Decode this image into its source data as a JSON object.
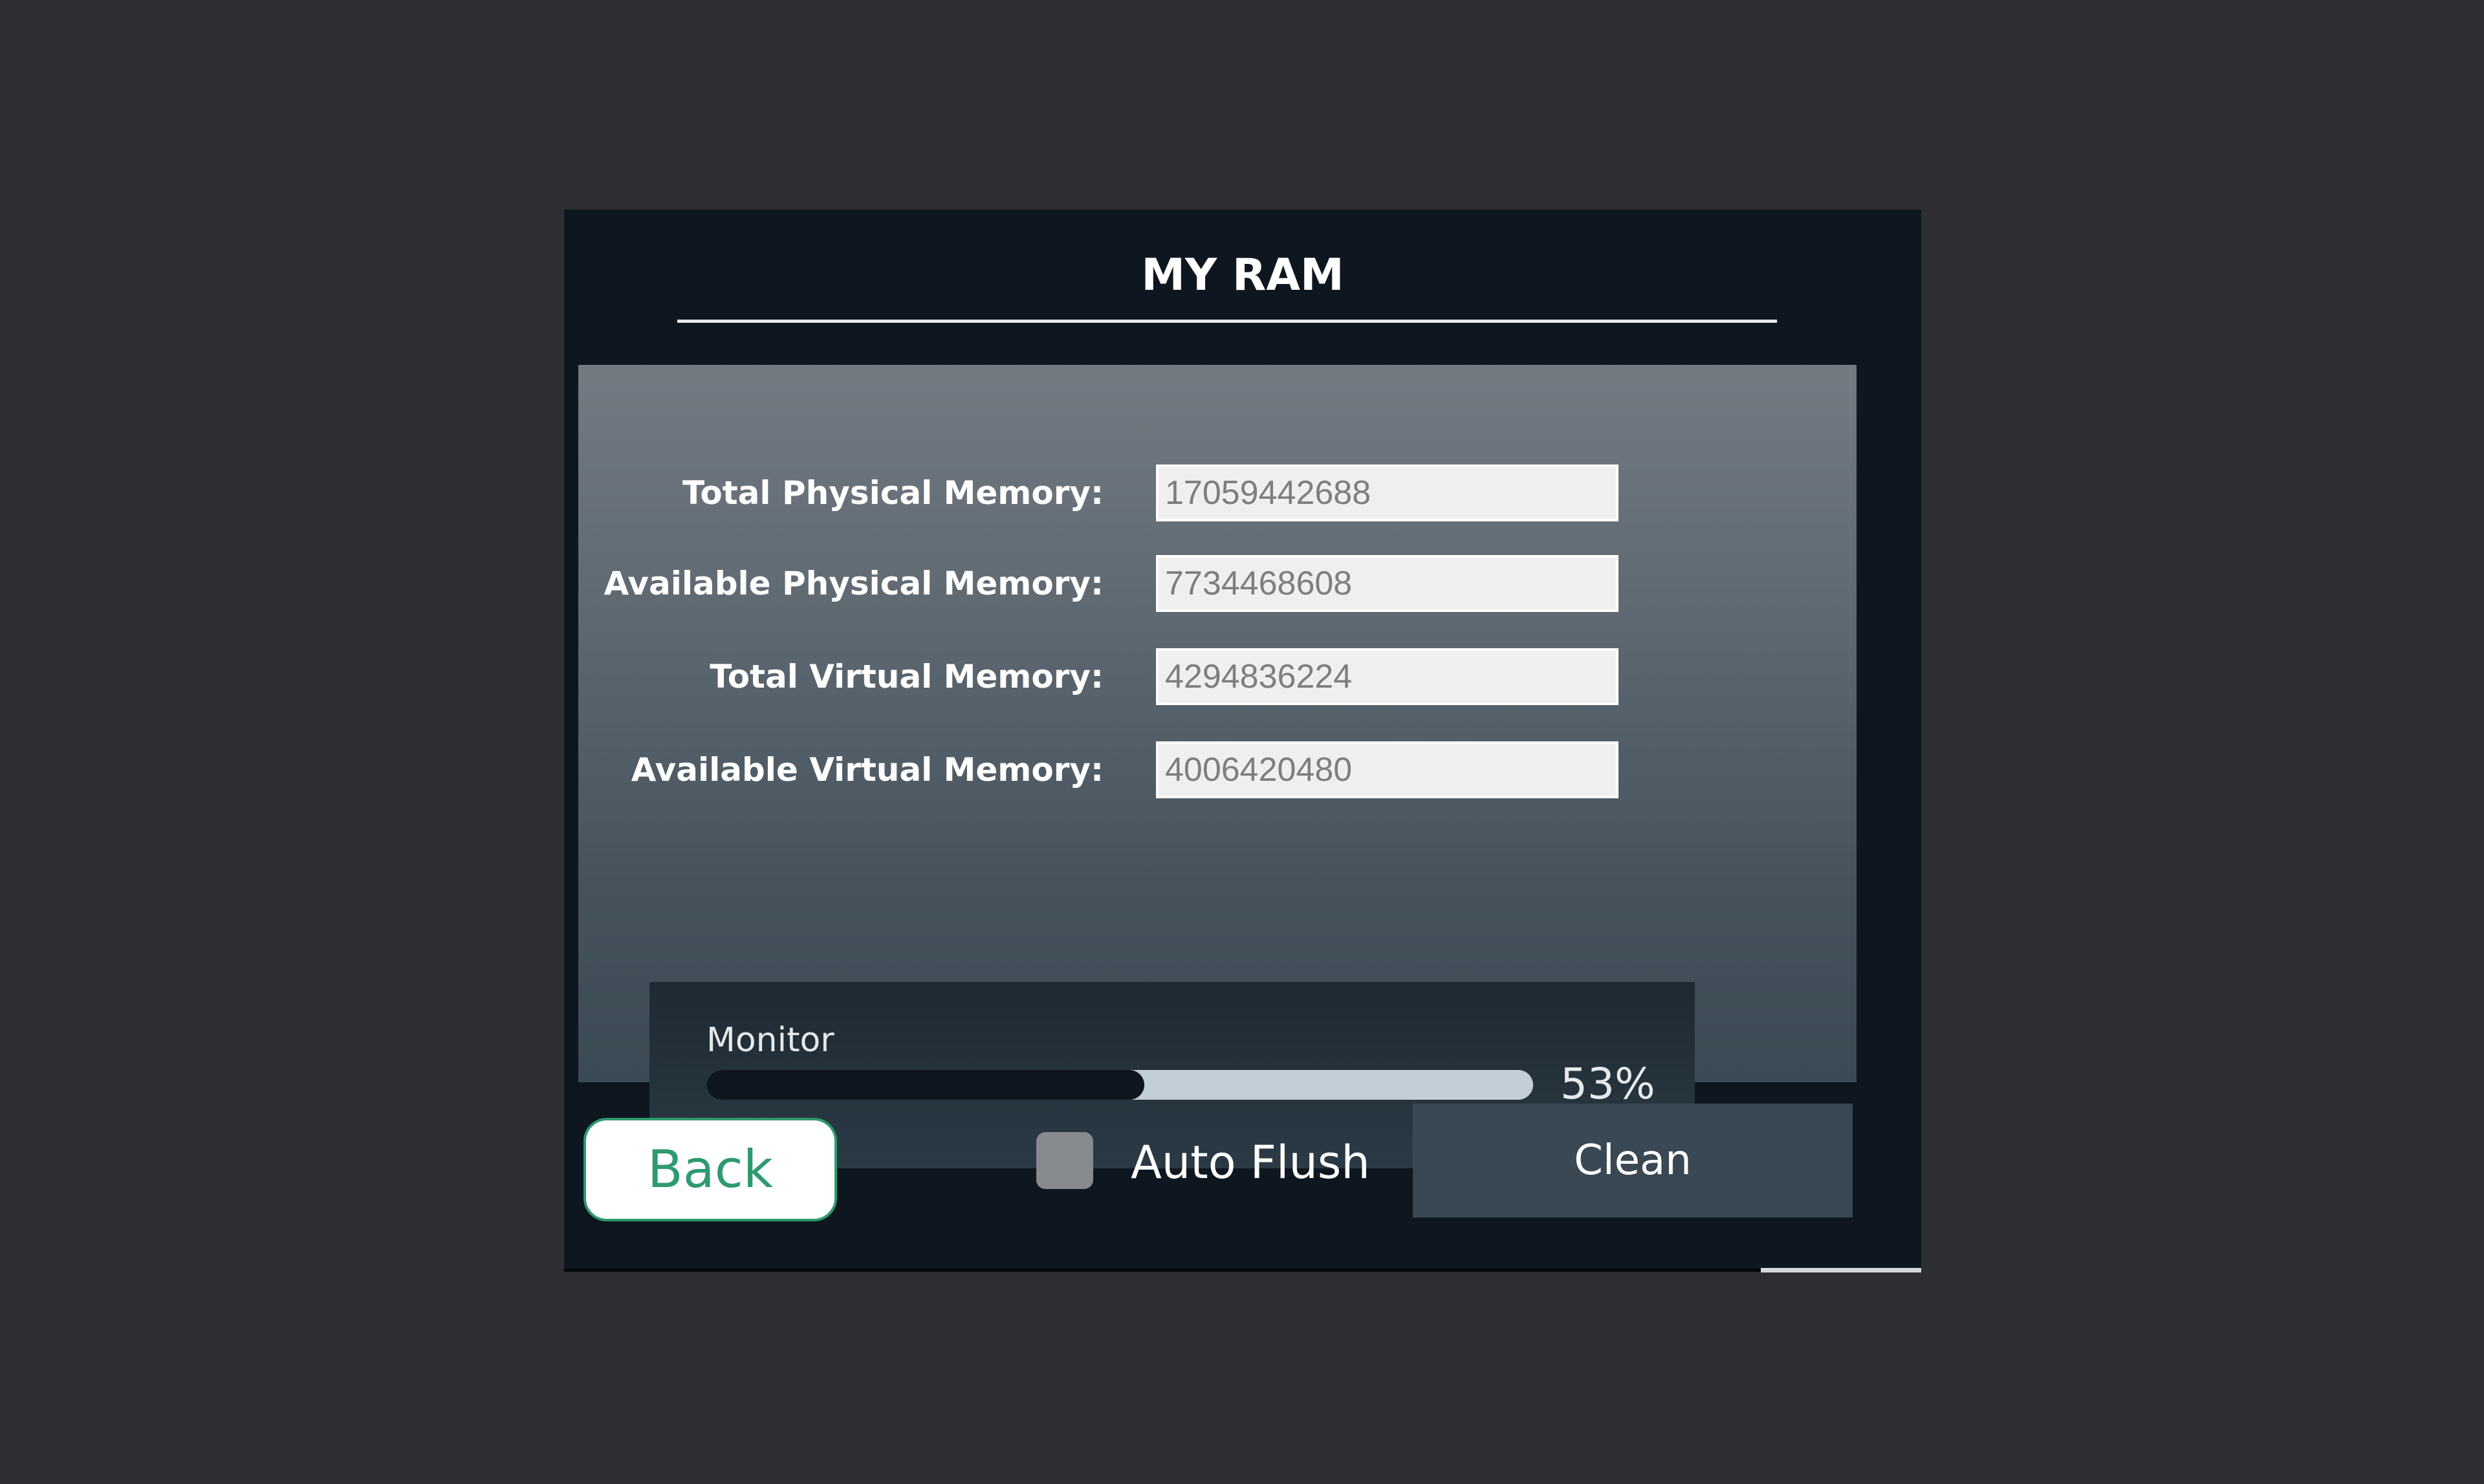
{
  "window": {
    "title": "MY RAM"
  },
  "memory_fields": [
    {
      "label": "Total Physical Memory:",
      "value": "17059442688"
    },
    {
      "label": "Available Physical Memory:",
      "value": "7734468608"
    },
    {
      "label": "Total Virtual Memory:",
      "value": "4294836224"
    },
    {
      "label": "Available Virtual Memory:",
      "value": "4006420480"
    }
  ],
  "monitor": {
    "label": "Monitor",
    "percent_value": 53,
    "percent_text": "53%"
  },
  "footer": {
    "back_label": "Back",
    "auto_flush_label": "Auto Flush",
    "auto_flush_checked": false,
    "clean_label": "Clean"
  },
  "colors": {
    "background": "#2e2f34",
    "window": "#0e1720",
    "accent_green": "#2e9a70",
    "progress_track": "#c2ced8",
    "clean_button": "#3a4853"
  }
}
